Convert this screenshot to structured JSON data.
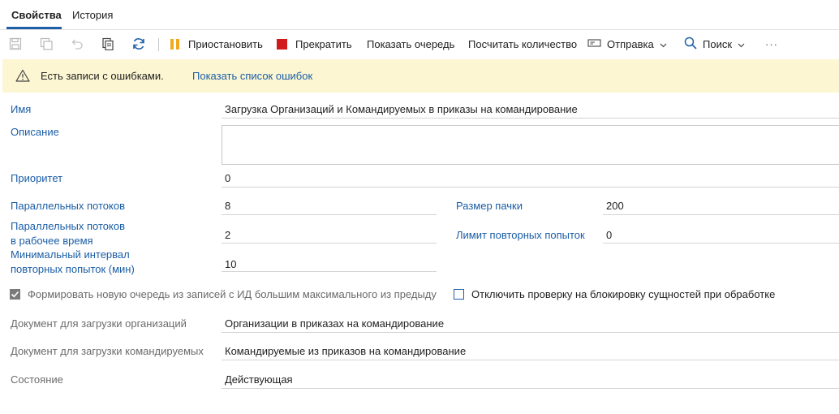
{
  "tabs": [
    {
      "label": "Свойства"
    },
    {
      "label": "История"
    }
  ],
  "toolbar": {
    "pause": "Приостановить",
    "stop": "Прекратить",
    "show_queue": "Показать очередь",
    "count": "Посчитать количество",
    "send": "Отправка",
    "search": "Поиск",
    "more": "···"
  },
  "banner": {
    "message": "Есть записи с ошибками.",
    "link": "Показать список ошибок"
  },
  "form": {
    "name": {
      "label": "Имя",
      "value": "Загрузка Организаций и Командируемых в приказы на командирование"
    },
    "description": {
      "label": "Описание",
      "value": ""
    },
    "priority": {
      "label": "Приоритет",
      "value": "0"
    },
    "threads": {
      "label": "Параллельных потоков",
      "value": "8"
    },
    "batch_size": {
      "label": "Размер пачки",
      "value": "200"
    },
    "threads_work_1": "Параллельных потоков",
    "threads_work_2": "в рабочее время",
    "threads_work_value": "2",
    "retry_limit": {
      "label": "Лимит повторных попыток",
      "value": "0"
    },
    "min_interval_1": "Минимальный интервал",
    "min_interval_2": "повторных попыток (мин)",
    "min_interval_value": "10",
    "checkbox_new_queue": {
      "label": "Формировать новую очередь из записей с ИД большим максимального из предыду",
      "checked": true
    },
    "checkbox_lock": {
      "label": "Отключить проверку на блокировку сущностей при обработке",
      "checked": false
    },
    "doc_orgs": {
      "label": "Документ для загрузки организаций",
      "value": "Организации в приказах на командирование"
    },
    "doc_travelers": {
      "label": "Документ для загрузки командируемых",
      "value": "Командируемые из приказов на командирование"
    },
    "state": {
      "label": "Состояние",
      "value": "Действующая"
    }
  }
}
